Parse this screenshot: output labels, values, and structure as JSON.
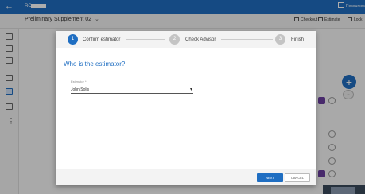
{
  "app": {
    "ro_label": "RO",
    "resources_label": "Resources",
    "page_title": "Preliminary Supplement 02",
    "actions": [
      {
        "label": "Checkout",
        "icon": "cart-icon"
      },
      {
        "label": "Estimate",
        "icon": "document-icon"
      },
      {
        "label": "Lock",
        "icon": "lock-icon"
      }
    ],
    "accent": "#1f6ec2"
  },
  "modal": {
    "steps": [
      {
        "number": "1",
        "label": "Confirm estimator",
        "active": true
      },
      {
        "number": "2",
        "label": "Check Advisor",
        "active": false
      },
      {
        "number": "3",
        "label": "Finish",
        "active": false
      }
    ],
    "heading": "Who is the estimator?",
    "field_label": "Estimator *",
    "selected_value": "John Solis",
    "next_label": "NEXT",
    "cancel_label": "CANCEL"
  }
}
